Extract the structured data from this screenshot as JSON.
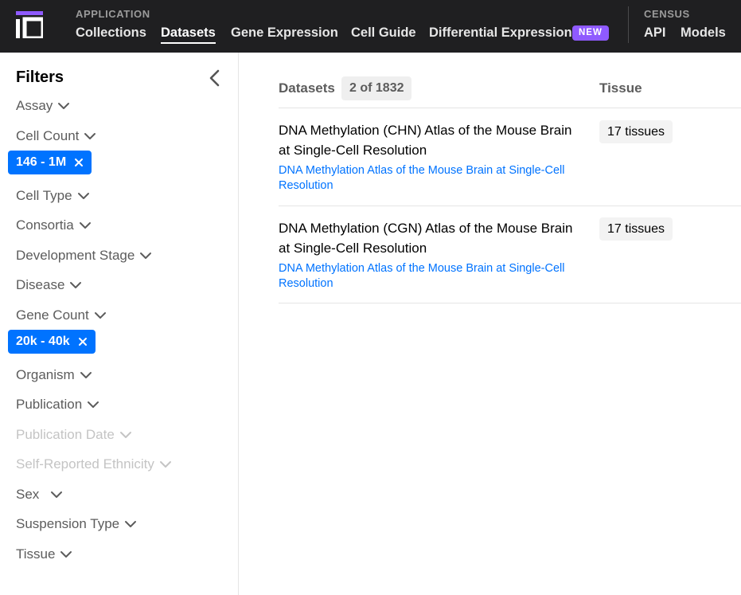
{
  "nav": {
    "application_label": "APPLICATION",
    "census_label": "CENSUS",
    "links": {
      "collections": "Collections",
      "datasets": "Datasets",
      "gene_expression": "Gene Expression",
      "cell_guide": "Cell Guide",
      "differential_expression": "Differential Expression",
      "api": "API",
      "models": "Models"
    },
    "new_badge": "NEW"
  },
  "sidebar": {
    "title": "Filters",
    "filters": {
      "assay": "Assay",
      "cell_count": "Cell Count",
      "cell_type": "Cell Type",
      "consortia": "Consortia",
      "development_stage": "Development Stage",
      "disease": "Disease",
      "gene_count": "Gene Count",
      "organism": "Organism",
      "publication": "Publication",
      "publication_date": "Publication Date",
      "self_reported_ethnicity": "Self-Reported Ethnicity",
      "sex": "Sex",
      "suspension_type": "Suspension Type",
      "tissue": "Tissue"
    },
    "chips": {
      "cell_count": "146 - 1M",
      "gene_count": "20k - 40k"
    }
  },
  "table": {
    "datasets_header": "Datasets",
    "count": "2 of 1832",
    "tissue_header": "Tissue",
    "rows": [
      {
        "title": "DNA Methylation (CHN) Atlas of the Mouse Brain at Single-Cell Resolution",
        "collection": "DNA Methylation Atlas of the Mouse Brain at Single-Cell Resolution",
        "tissue": "17 tissues"
      },
      {
        "title": "DNA Methylation (CGN) Atlas of the Mouse Brain at Single-Cell Resolution",
        "collection": "DNA Methylation Atlas of the Mouse Brain at Single-Cell Resolution",
        "tissue": "17 tissues"
      }
    ]
  },
  "colors": {
    "nav_bg": "#1f1f21",
    "accent_blue": "#0073ff",
    "new_badge": "#8f5aff"
  }
}
